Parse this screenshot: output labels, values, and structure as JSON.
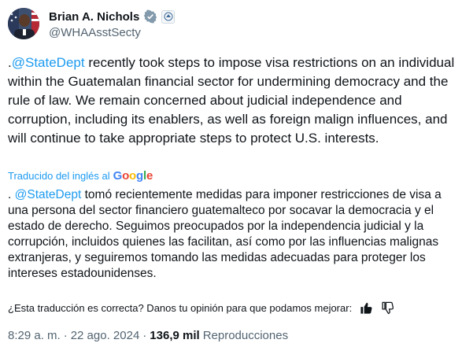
{
  "author": {
    "name": "Brian A. Nichols",
    "handle": "@WHAAsstSecty"
  },
  "tweet": {
    "prefix": ".",
    "mention": "@StateDept",
    "body": " recently took steps to impose visa restrictions on an individual within the Guatemalan financial sector for undermining democracy and the rule of law. We remain concerned about judicial independence and corruption, including its enablers, as well as foreign malign influences, and will continue to take appropriate steps to protect U.S. interests."
  },
  "translation": {
    "label": "Traducido del inglés al",
    "provider": "Google",
    "prefix": ". ",
    "mention": "@StateDept",
    "body": " tomó recientemente medidas para imponer restricciones de visa a una persona del sector financiero guatemalteco por socavar la democracia y el estado de derecho. Seguimos preocupados por la independencia judicial y la corrupción, incluidos quienes las facilitan, así como por las influencias malignas extranjeras, y seguiremos tomando las medidas adecuadas para proteger los intereses estadounidenses.",
    "feedback_question": "¿Esta traducción es correcta? Danos tu opinión para que podamos mejorar:"
  },
  "meta": {
    "time": "8:29 a. m.",
    "sep1": "·",
    "date": "22 ago. 2024",
    "sep2": "·",
    "views_count": "136,9 mil",
    "views_label": "Reproducciones"
  },
  "colors": {
    "link": "#1d9bf0",
    "text": "#0f1419",
    "secondary": "#536471"
  },
  "icons": [
    "verified-badge-icon",
    "government-badge-icon",
    "google-logo",
    "thumbs-up-icon",
    "thumbs-down-icon"
  ]
}
